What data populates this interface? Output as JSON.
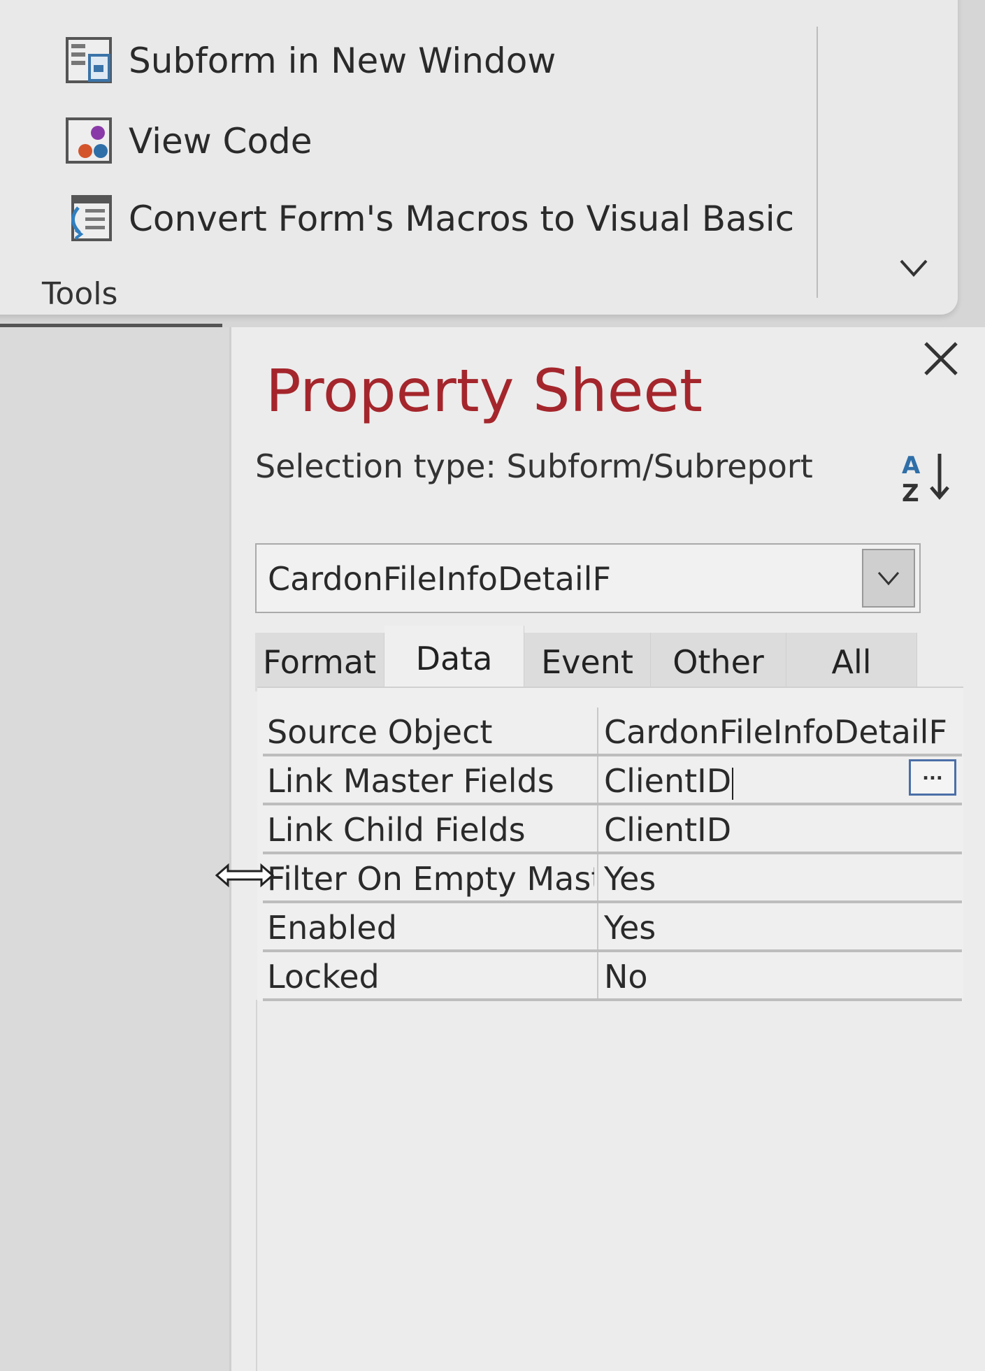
{
  "ribbon": {
    "items": [
      {
        "label": "Subform in New Window",
        "icon": "subform-window-icon"
      },
      {
        "label": "View Code",
        "icon": "view-code-icon"
      },
      {
        "label": "Convert Form's Macros to Visual Basic",
        "icon": "convert-macros-icon"
      }
    ],
    "group_label": "Tools"
  },
  "property_sheet": {
    "title": "Property Sheet",
    "selection_type": "Selection type:  Subform/Subreport",
    "selected_object": "CardonFileInfoDetailF",
    "tabs": [
      {
        "label": "Format",
        "active": false
      },
      {
        "label": "Data",
        "active": true
      },
      {
        "label": "Event",
        "active": false
      },
      {
        "label": "Other",
        "active": false
      },
      {
        "label": "All",
        "active": false
      }
    ],
    "properties": [
      {
        "name": "Source Object",
        "value": "CardonFileInfoDetailF"
      },
      {
        "name": "Link Master Fields",
        "value": "ClientID"
      },
      {
        "name": "Link Child Fields",
        "value": "ClientID"
      },
      {
        "name": "Filter On Empty Maste",
        "value": "Yes"
      },
      {
        "name": "Enabled",
        "value": "Yes"
      },
      {
        "name": "Locked",
        "value": "No"
      }
    ],
    "build_button_label": "...",
    "title_color": "#a4262c"
  }
}
